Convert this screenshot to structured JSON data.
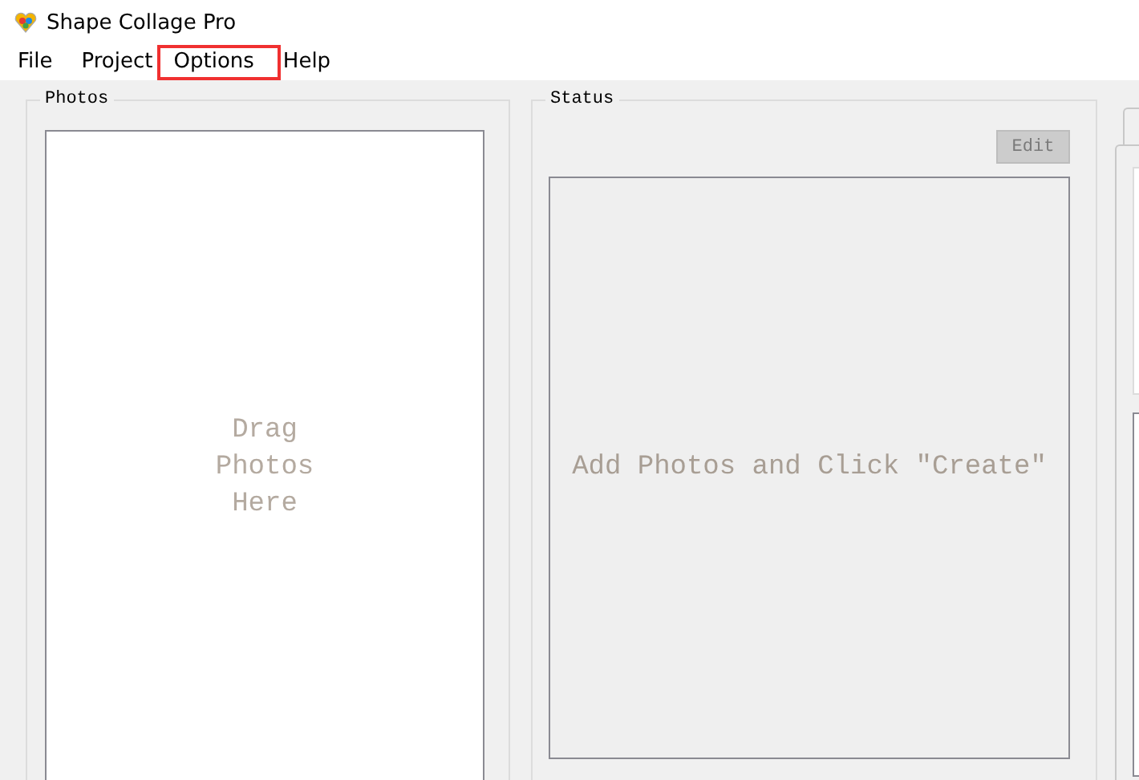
{
  "window": {
    "title": "Shape Collage Pro"
  },
  "menu": [
    {
      "label": "File",
      "highlighted": false
    },
    {
      "label": "Project",
      "highlighted": false
    },
    {
      "label": "Options",
      "highlighted": true
    },
    {
      "label": "Help",
      "highlighted": false
    }
  ],
  "photos": {
    "title": "Photos",
    "hint": [
      "Drag",
      "Photos",
      "Here"
    ]
  },
  "status": {
    "title": "Status",
    "edit_button": {
      "label": "Edit",
      "disabled": true
    },
    "hint": "Add Photos and Click \"Create\""
  }
}
